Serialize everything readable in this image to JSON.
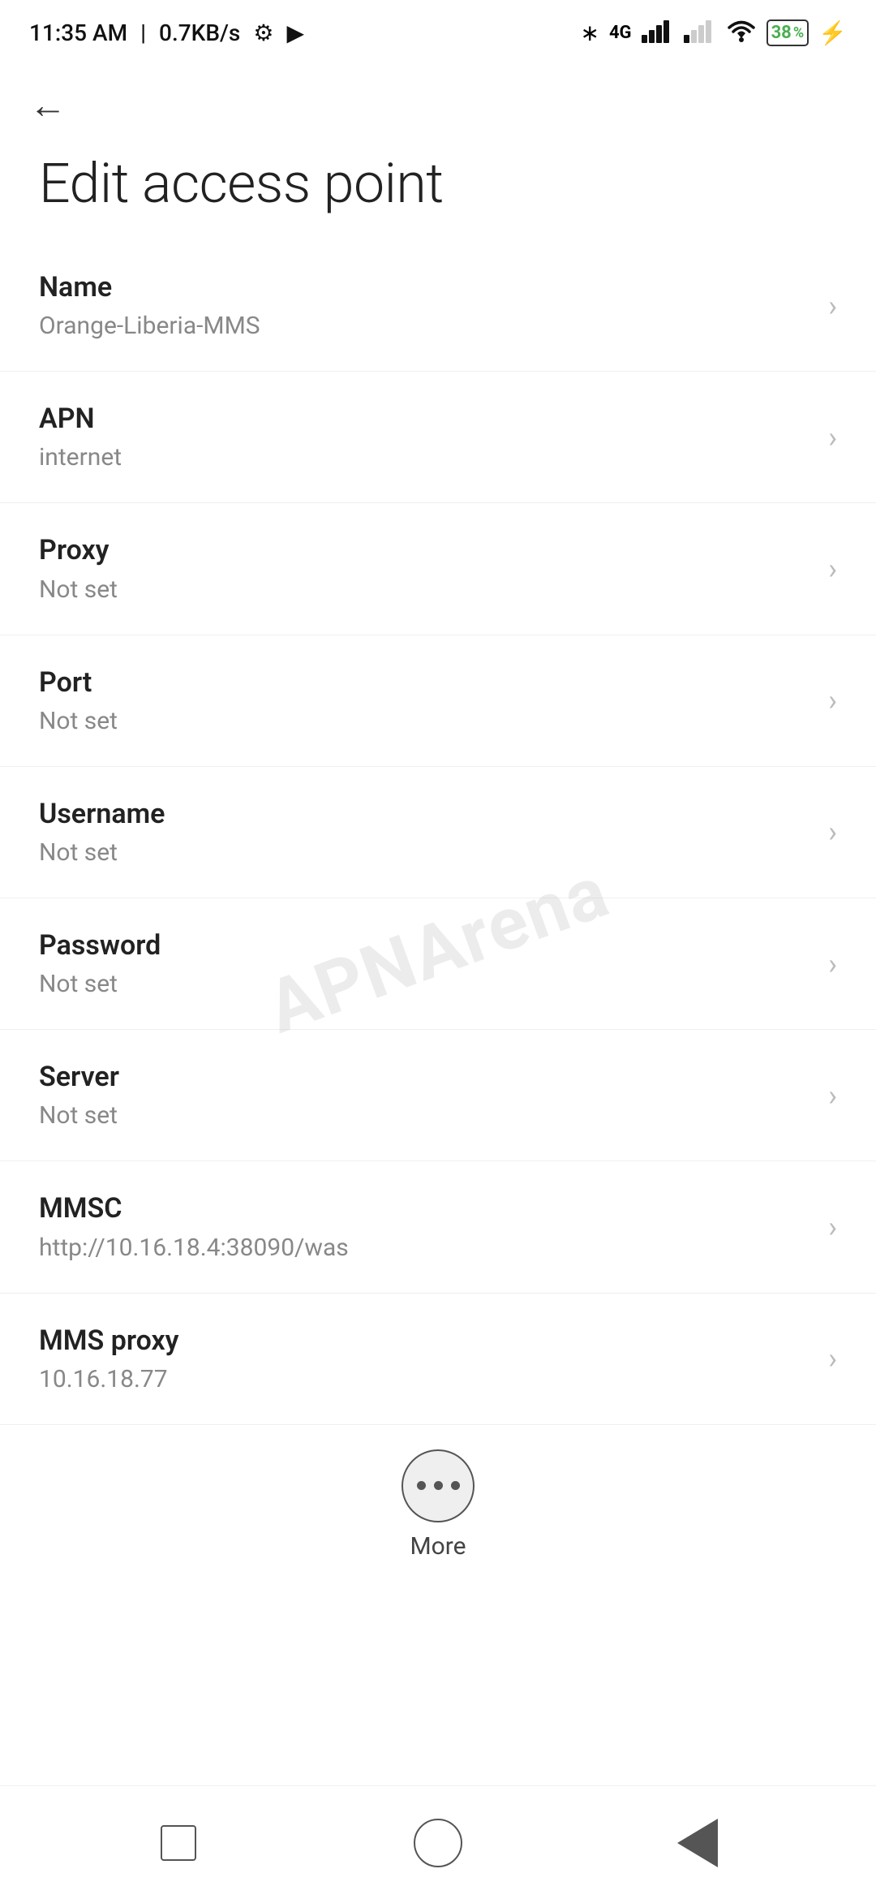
{
  "statusBar": {
    "time": "11:35 AM",
    "speed": "0.7KB/s"
  },
  "page": {
    "title": "Edit access point",
    "backLabel": "←"
  },
  "items": [
    {
      "label": "Name",
      "value": "Orange-Liberia-MMS"
    },
    {
      "label": "APN",
      "value": "internet"
    },
    {
      "label": "Proxy",
      "value": "Not set"
    },
    {
      "label": "Port",
      "value": "Not set"
    },
    {
      "label": "Username",
      "value": "Not set"
    },
    {
      "label": "Password",
      "value": "Not set"
    },
    {
      "label": "Server",
      "value": "Not set"
    },
    {
      "label": "MMSC",
      "value": "http://10.16.18.4:38090/was"
    },
    {
      "label": "MMS proxy",
      "value": "10.16.18.77"
    }
  ],
  "moreButton": {
    "label": "More"
  },
  "watermark": "APNArena",
  "nav": {
    "square": "recent-apps",
    "circle": "home",
    "triangle": "back"
  }
}
